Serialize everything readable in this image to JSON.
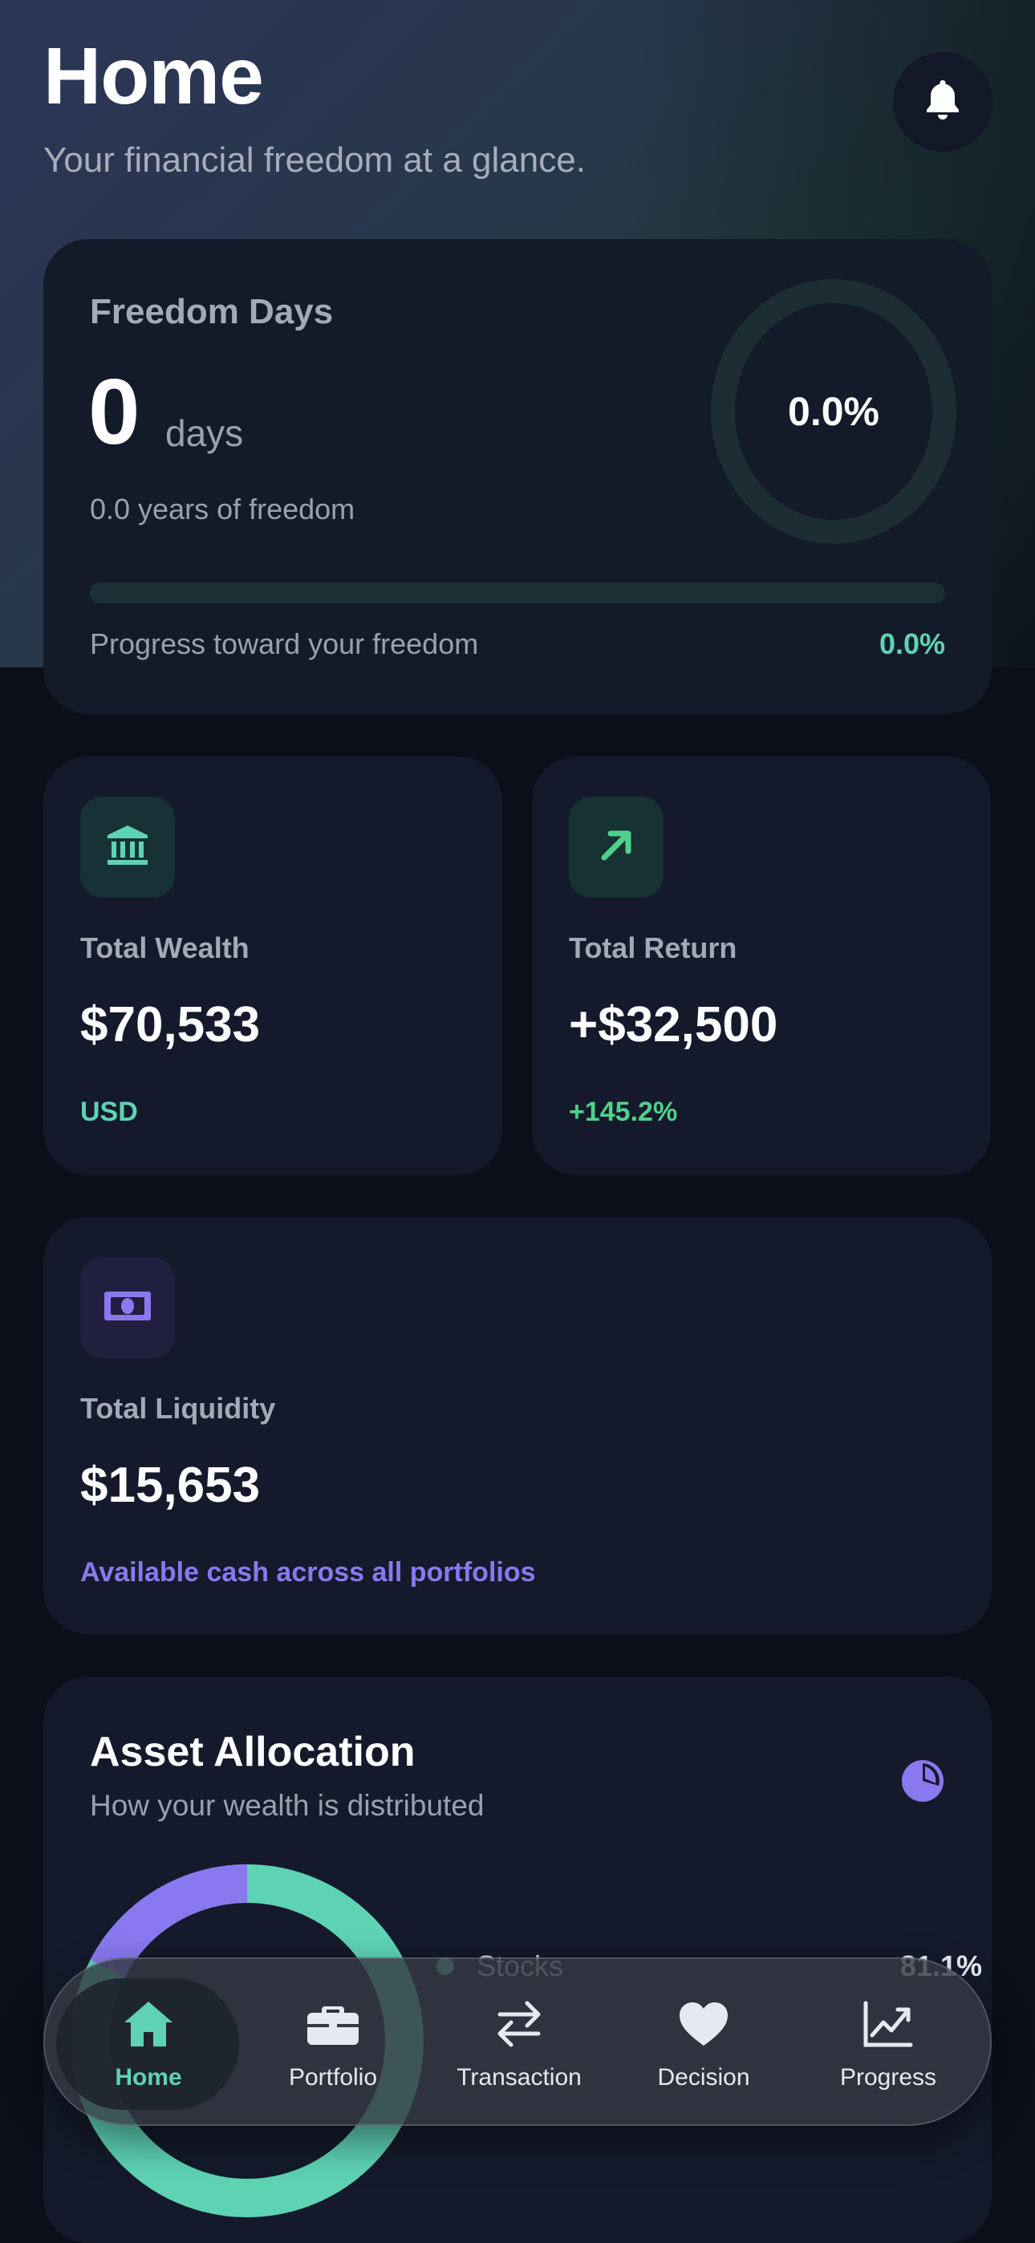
{
  "header": {
    "title": "Home",
    "subtitle": "Your financial freedom at a glance."
  },
  "freedom": {
    "label": "Freedom Days",
    "value": "0",
    "unit": "days",
    "years_text": "0.0 years of freedom",
    "ring_percent": "0.0%",
    "progress_label": "Progress toward your freedom",
    "progress_percent": "0.0%",
    "progress_fraction": 0.0
  },
  "wealth": {
    "label": "Total Wealth",
    "value": "$70,533",
    "sub": "USD"
  },
  "return": {
    "label": "Total Return",
    "value": "+$32,500",
    "sub": "+145.2%"
  },
  "liquidity": {
    "label": "Total Liquidity",
    "value": "$15,653",
    "sub": "Available cash across all portfolios"
  },
  "allocation": {
    "title": "Asset Allocation",
    "subtitle": "How your wealth is distributed",
    "legend": [
      {
        "name": "Stocks",
        "percent": "81.1%",
        "color": "#5ed3b4"
      }
    ]
  },
  "tabbar": {
    "tabs": [
      {
        "label": "Home",
        "icon": "house-icon"
      },
      {
        "label": "Portfolio",
        "icon": "briefcase-icon"
      },
      {
        "label": "Transaction",
        "icon": "arrows-exchange-icon"
      },
      {
        "label": "Decision",
        "icon": "heart-icon"
      },
      {
        "label": "Progress",
        "icon": "chart-line-icon"
      }
    ]
  },
  "colors": {
    "accent_teal": "#5ed3b4",
    "accent_green": "#4fd18b",
    "accent_purple": "#8a78f0",
    "card_bg": "#141a2b",
    "page_bg": "#0b0f1a"
  }
}
